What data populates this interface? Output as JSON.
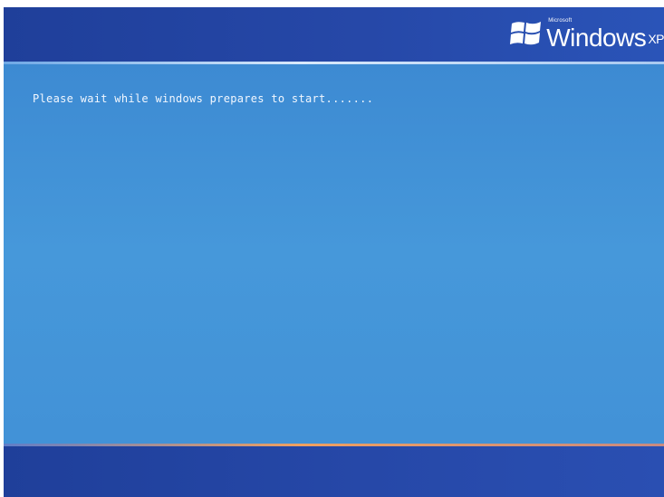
{
  "header": {
    "brand_small": "Microsoft",
    "brand_name": "Windows",
    "brand_suffix": "XP"
  },
  "main": {
    "message": "Please wait while windows prepares to start......."
  },
  "colors": {
    "screen_blue": "#4698da",
    "bar_blue": "#2648a8",
    "text": "#f2f7ff"
  },
  "icons": {
    "logo": "windows-flag-icon"
  }
}
